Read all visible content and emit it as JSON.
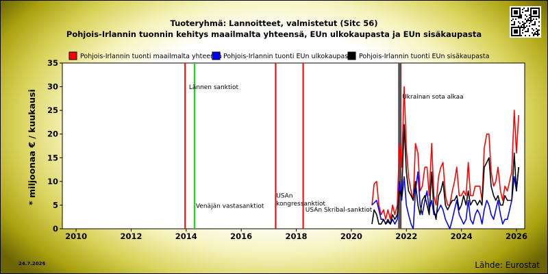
{
  "header": {
    "title_line1": "Tuoteryhmä: Lannoitteet, valmistetut (Sitc 56)",
    "title_line2": "Pohjois-Irlannin tuonnin kehitys maailmalta yhteensä, EUn ulkokaupasta ja EUn sisäkaupasta"
  },
  "footer": {
    "date": "24.7.2026",
    "source": "Lähde: Eurostat"
  },
  "chart_data": {
    "type": "line",
    "title": "Tuoteryhmä: Lannoitteet, valmistetut (Sitc 56)",
    "subtitle": "Pohjois-Irlannin tuonnin kehitys maailmalta yhteensä, EUn ulkokaupasta ja EUn sisäkaupasta",
    "ylabel": "* miljoonaa € / kuukausi",
    "xlabel": "",
    "xlim": [
      2009.5,
      2026.3
    ],
    "ylim": [
      0,
      35
    ],
    "xticks": [
      2010,
      2012,
      2014,
      2016,
      2018,
      2020,
      2022,
      2024,
      2026
    ],
    "yticks": [
      0,
      5,
      10,
      15,
      20,
      25,
      30,
      35
    ],
    "grid": false,
    "legend_position": "top-left",
    "colors": {
      "world": "#ff0000",
      "extra_eu": "#0000ff",
      "intra_eu": "#000000"
    },
    "series": [
      {
        "name": "Pohjois-Irlannin tuonti maailmalta yhteensä",
        "color": "#ff0000",
        "x": [
          2020.75,
          2020.83,
          2020.92,
          2021.0,
          2021.08,
          2021.17,
          2021.25,
          2021.33,
          2021.42,
          2021.5,
          2021.58,
          2021.67,
          2021.75,
          2021.83,
          2021.92,
          2022.0,
          2022.08,
          2022.17,
          2022.25,
          2022.33,
          2022.42,
          2022.5,
          2022.58,
          2022.67,
          2022.75,
          2022.83,
          2022.92,
          2023.0,
          2023.08,
          2023.17,
          2023.25,
          2023.33,
          2023.42,
          2023.5,
          2023.58,
          2023.67,
          2023.75,
          2023.83,
          2023.92,
          2024.0,
          2024.08,
          2024.17,
          2024.25,
          2024.33,
          2024.42,
          2024.5,
          2024.58,
          2024.67,
          2024.75,
          2024.83,
          2024.92,
          2025.0,
          2025.08,
          2025.17,
          2025.25,
          2025.33,
          2025.42,
          2025.5,
          2025.58,
          2025.67,
          2025.75,
          2025.83,
          2025.92,
          2026.0,
          2026.08
        ],
        "y": [
          5,
          9.5,
          10,
          5,
          3,
          4,
          2,
          4,
          2,
          5,
          3,
          5,
          18,
          13,
          30,
          17,
          11,
          8,
          6,
          18,
          16,
          8,
          9,
          13,
          13,
          7,
          18,
          7,
          5,
          11,
          13,
          14,
          7,
          5,
          5,
          8,
          10,
          13,
          7,
          7,
          8,
          7,
          14,
          7,
          7,
          9,
          9,
          9,
          6,
          17,
          20,
          20,
          12,
          9,
          10,
          13,
          8,
          6,
          9,
          8,
          10,
          12,
          25,
          16,
          24
        ]
      },
      {
        "name": "Pohjois-Irlannin tuonti EUn ulkokaupasta",
        "color": "#0000ff",
        "x": [
          2020.75,
          2020.83,
          2020.92,
          2021.0,
          2021.08,
          2021.17,
          2021.25,
          2021.33,
          2021.42,
          2021.5,
          2021.58,
          2021.67,
          2021.75,
          2021.83,
          2021.92,
          2022.0,
          2022.08,
          2022.17,
          2022.25,
          2022.33,
          2022.42,
          2022.5,
          2022.58,
          2022.67,
          2022.75,
          2022.83,
          2022.92,
          2023.0,
          2023.08,
          2023.17,
          2023.25,
          2023.33,
          2023.42,
          2023.5,
          2023.58,
          2023.67,
          2023.75,
          2023.83,
          2023.92,
          2024.0,
          2024.08,
          2024.17,
          2024.25,
          2024.33,
          2024.42,
          2024.5,
          2024.58,
          2024.67,
          2024.75,
          2024.83,
          2024.92,
          2025.0,
          2025.08,
          2025.17,
          2025.25,
          2025.33,
          2025.42,
          2025.5,
          2025.58,
          2025.67,
          2025.75,
          2025.83,
          2025.92,
          2026.0,
          2026.08
        ],
        "y": [
          5,
          5.5,
          6,
          4,
          2,
          2,
          1,
          1.5,
          1,
          2,
          1,
          2,
          10,
          6,
          11,
          5,
          3,
          1,
          0,
          8,
          12,
          5,
          3,
          6,
          8,
          4,
          6,
          3,
          3,
          4,
          5,
          4,
          2,
          1,
          0,
          2,
          4,
          6,
          3,
          2,
          1,
          2,
          6,
          2,
          1,
          3,
          4,
          3,
          1,
          4,
          6,
          5,
          3,
          2,
          4,
          6,
          3,
          1,
          2,
          2,
          4,
          6,
          11,
          8,
          13
        ]
      },
      {
        "name": "Pohjois-Irlannin tuonti EUn sisäkaupasta",
        "color": "#000000",
        "x": [
          2020.75,
          2020.83,
          2020.92,
          2021.0,
          2021.08,
          2021.17,
          2021.25,
          2021.33,
          2021.42,
          2021.5,
          2021.58,
          2021.67,
          2021.75,
          2021.83,
          2021.92,
          2022.0,
          2022.08,
          2022.17,
          2022.25,
          2022.33,
          2022.42,
          2022.5,
          2022.58,
          2022.67,
          2022.75,
          2022.83,
          2022.92,
          2023.0,
          2023.08,
          2023.17,
          2023.25,
          2023.33,
          2023.42,
          2023.5,
          2023.58,
          2023.67,
          2023.75,
          2023.83,
          2023.92,
          2024.0,
          2024.08,
          2024.17,
          2024.25,
          2024.33,
          2024.42,
          2024.5,
          2024.58,
          2024.67,
          2024.75,
          2024.83,
          2024.92,
          2025.0,
          2025.08,
          2025.17,
          2025.25,
          2025.33,
          2025.42,
          2025.5,
          2025.58,
          2025.67,
          2025.75,
          2025.83,
          2025.92,
          2026.0,
          2026.08
        ],
        "y": [
          1,
          4,
          3,
          1,
          1,
          2,
          1,
          2,
          1,
          3,
          2,
          3,
          8,
          7,
          22,
          12,
          8,
          7,
          6,
          10,
          5,
          3,
          6,
          7,
          5,
          3,
          12,
          4,
          2,
          7,
          8,
          10,
          5,
          4,
          5,
          6,
          6,
          7,
          4,
          5,
          7,
          5,
          8,
          5,
          6,
          6,
          5,
          6,
          5,
          13,
          14,
          15,
          9,
          7,
          6,
          7,
          5,
          5,
          7,
          6,
          6,
          6,
          16,
          8,
          13
        ]
      }
    ],
    "vertical_lines": [
      {
        "x": 2013.96,
        "color": "#ff0000"
      },
      {
        "x": 2014.3,
        "color": "#00dd00"
      },
      {
        "x": 2017.25,
        "color": "#ff0000"
      },
      {
        "x": 2018.25,
        "color": "#ff0000"
      },
      {
        "x": 2021.8,
        "color": "#ff0000"
      },
      {
        "x": 2021.75,
        "color": "#555555",
        "width": 4
      }
    ],
    "annotations": [
      {
        "text": "Lännen sanktiot",
        "x": 2014.1,
        "y": 29.5
      },
      {
        "text": "Venäjän vastasanktiot",
        "x": 2014.35,
        "y": 4.4
      },
      {
        "text": "USAn",
        "x": 2017.27,
        "y": 6.6
      },
      {
        "text": "kongressanktiot",
        "x": 2017.27,
        "y": 4.9
      },
      {
        "text": "USAn Skribal-sanktiot",
        "x": 2018.33,
        "y": 3.6
      },
      {
        "text": "Ukrainan sota alkaa",
        "x": 2021.85,
        "y": 27.5
      }
    ]
  }
}
